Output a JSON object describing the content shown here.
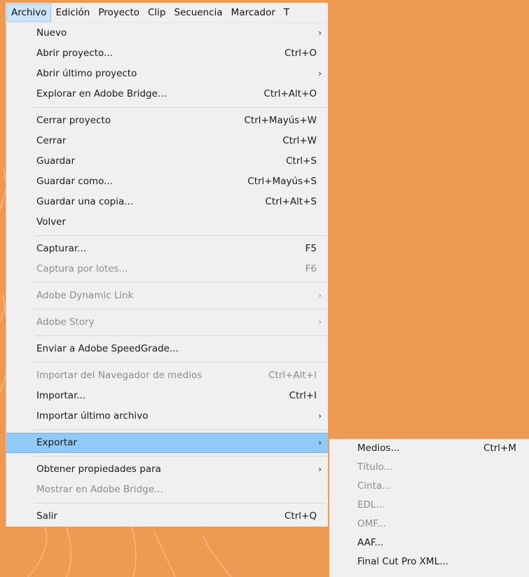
{
  "menubar": {
    "items": [
      "Archivo",
      "Edición",
      "Proyecto",
      "Clip",
      "Secuencia",
      "Marcador",
      "T"
    ]
  },
  "file_menu": {
    "groups": [
      [
        {
          "label": "Nuevo",
          "shortcut": "",
          "submenu": true,
          "disabled": false
        },
        {
          "label": "Abrir proyecto...",
          "shortcut": "Ctrl+O",
          "submenu": false,
          "disabled": false
        },
        {
          "label": "Abrir último proyecto",
          "shortcut": "",
          "submenu": true,
          "disabled": false
        },
        {
          "label": "Explorar en Adobe Bridge...",
          "shortcut": "Ctrl+Alt+O",
          "submenu": false,
          "disabled": false
        }
      ],
      [
        {
          "label": "Cerrar proyecto",
          "shortcut": "Ctrl+Mayús+W",
          "submenu": false,
          "disabled": false
        },
        {
          "label": "Cerrar",
          "shortcut": "Ctrl+W",
          "submenu": false,
          "disabled": false
        },
        {
          "label": "Guardar",
          "shortcut": "Ctrl+S",
          "submenu": false,
          "disabled": false
        },
        {
          "label": "Guardar como...",
          "shortcut": "Ctrl+Mayús+S",
          "submenu": false,
          "disabled": false
        },
        {
          "label": "Guardar una copia...",
          "shortcut": "Ctrl+Alt+S",
          "submenu": false,
          "disabled": false
        },
        {
          "label": "Volver",
          "shortcut": "",
          "submenu": false,
          "disabled": false
        }
      ],
      [
        {
          "label": "Capturar...",
          "shortcut": "F5",
          "submenu": false,
          "disabled": false
        },
        {
          "label": "Captura por lotes...",
          "shortcut": "F6",
          "submenu": false,
          "disabled": true
        }
      ],
      [
        {
          "label": "Adobe Dynamic Link",
          "shortcut": "",
          "submenu": true,
          "disabled": true
        }
      ],
      [
        {
          "label": "Adobe Story",
          "shortcut": "",
          "submenu": true,
          "disabled": true
        }
      ],
      [
        {
          "label": "Enviar a Adobe SpeedGrade...",
          "shortcut": "",
          "submenu": false,
          "disabled": false
        }
      ],
      [
        {
          "label": "Importar del Navegador de medios",
          "shortcut": "Ctrl+Alt+I",
          "submenu": false,
          "disabled": true
        },
        {
          "label": "Importar...",
          "shortcut": "Ctrl+I",
          "submenu": false,
          "disabled": false
        },
        {
          "label": "Importar último archivo",
          "shortcut": "",
          "submenu": true,
          "disabled": false
        }
      ],
      [
        {
          "label": "Exportar",
          "shortcut": "",
          "submenu": true,
          "disabled": false,
          "highlighted": true
        }
      ],
      [
        {
          "label": "Obtener propiedades para",
          "shortcut": "",
          "submenu": true,
          "disabled": false
        },
        {
          "label": "Mostrar en Adobe Bridge...",
          "shortcut": "",
          "submenu": false,
          "disabled": true
        }
      ],
      [
        {
          "label": "Salir",
          "shortcut": "Ctrl+Q",
          "submenu": false,
          "disabled": false
        }
      ]
    ],
    "submenu_arrow": "›"
  },
  "export_submenu": {
    "items": [
      {
        "label": "Medios...",
        "shortcut": "Ctrl+M",
        "disabled": false
      },
      {
        "label": "Título...",
        "shortcut": "",
        "disabled": true
      },
      {
        "label": "Cinta...",
        "shortcut": "",
        "disabled": true
      },
      {
        "label": "EDL...",
        "shortcut": "",
        "disabled": true
      },
      {
        "label": "OMF...",
        "shortcut": "",
        "disabled": true
      },
      {
        "label": "AAF...",
        "shortcut": "",
        "disabled": false
      },
      {
        "label": "Final Cut Pro XML...",
        "shortcut": "",
        "disabled": false
      }
    ]
  },
  "colors": {
    "background": "#ef9a52",
    "menu_bg": "#f0f0f0",
    "highlight": "#91c9f7",
    "disabled_text": "#8c8c8c"
  }
}
